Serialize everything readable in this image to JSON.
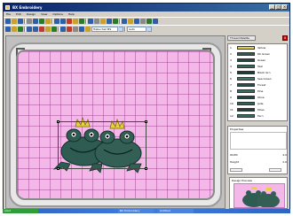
{
  "window": {
    "title": "BX Embroidery",
    "buttons": [
      "_",
      "□",
      "×"
    ]
  },
  "menu": {
    "items": [
      "File",
      "Edit",
      "Design",
      "View",
      "Options",
      "Help"
    ]
  },
  "toolbar": {
    "colors": {
      "icon_a": "#2e5fa8",
      "icon_b": "#c9a227",
      "icon_c": "#c0392b",
      "icon_d": "#2a7a2a"
    },
    "combo_value": "Trebuchet MS",
    "combo2_value": "Auto"
  },
  "canvas": {
    "background_color": "#f4b8e8",
    "grid_color": "#963c8c",
    "design_name": "Frog Prince"
  },
  "panel": {
    "tab_label": "Thread Palette",
    "close_label": "x",
    "threads": [
      {
        "num": "1",
        "color": "#e8d13a",
        "desc": "Yellow"
      },
      {
        "num": "2",
        "color": "#2e5c52",
        "desc": "Dk Green"
      },
      {
        "num": "3",
        "color": "#1e4a40",
        "desc": "Green"
      },
      {
        "num": "4",
        "color": "#2f6a5e",
        "desc": "Teal"
      },
      {
        "num": "5",
        "color": "#1a3e36",
        "desc": "Black Grn"
      },
      {
        "num": "6",
        "color": "#3b786b",
        "desc": "Sea Green"
      },
      {
        "num": "7",
        "color": "#24524a",
        "desc": "Forest"
      },
      {
        "num": "8",
        "color": "#356e62",
        "desc": "Pine"
      },
      {
        "num": "9",
        "color": "#1c4640",
        "desc": "Olive"
      },
      {
        "num": "10",
        "color": "#2b6356",
        "desc": "Jade"
      },
      {
        "num": "11",
        "color": "#203f39",
        "desc": "Moss"
      },
      {
        "num": "12",
        "color": "#30705f",
        "desc": "Fern"
      }
    ],
    "properties_label": "Properties",
    "prop_rows": [
      {
        "name": "Width",
        "value": "4.0"
      },
      {
        "name": "Height",
        "value": "2.6"
      }
    ],
    "preview_label": "Design Preview"
  },
  "statusbar": {
    "tabs": [
      "Design",
      "Threads",
      "Info"
    ]
  },
  "taskbar": {
    "start_label": "start",
    "tasks": [
      "BX Embroidery",
      "Untitled"
    ]
  }
}
